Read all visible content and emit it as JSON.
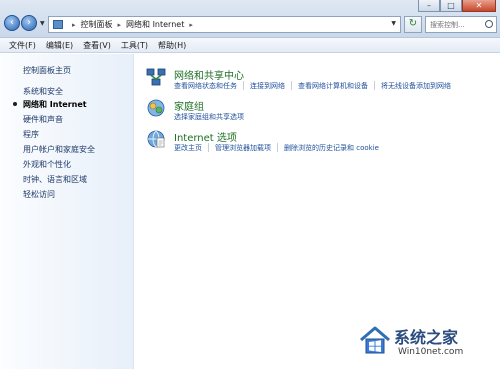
{
  "address": {
    "crumbs": [
      "控制面板",
      "网络和 Internet"
    ]
  },
  "search": {
    "placeholder": "搜索控制..."
  },
  "menu": [
    "文件(F)",
    "编辑(E)",
    "查看(V)",
    "工具(T)",
    "帮助(H)"
  ],
  "sidebar": {
    "items": [
      {
        "label": "控制面板主页"
      },
      {
        "label": "系统和安全"
      },
      {
        "label": "网络和 Internet",
        "current": true
      },
      {
        "label": "硬件和声音"
      },
      {
        "label": "程序"
      },
      {
        "label": "用户帐户和家庭安全"
      },
      {
        "label": "外观和个性化"
      },
      {
        "label": "时钟、语言和区域"
      },
      {
        "label": "轻松访问"
      }
    ]
  },
  "categories": [
    {
      "title": "网络和共享中心",
      "icon": "network-sharing-center-icon",
      "tasks": [
        "查看网络状态和任务",
        "连接到网络",
        "查看网络计算机和设备",
        "将无线设备添加到网络"
      ]
    },
    {
      "title": "家庭组",
      "icon": "homegroup-icon",
      "tasks": [
        "选择家庭组和共享选项"
      ]
    },
    {
      "title": "Internet 选项",
      "icon": "internet-options-icon",
      "tasks": [
        "更改主页",
        "管理浏览器加载项",
        "删除浏览的历史记录和 cookie"
      ]
    }
  ],
  "watermark": {
    "title": "系统之家",
    "site": "Win10net.com"
  },
  "colors": {
    "link": "#1f4f9c",
    "category_title": "#1e6f24",
    "sidebar_link": "#1f3a68"
  }
}
